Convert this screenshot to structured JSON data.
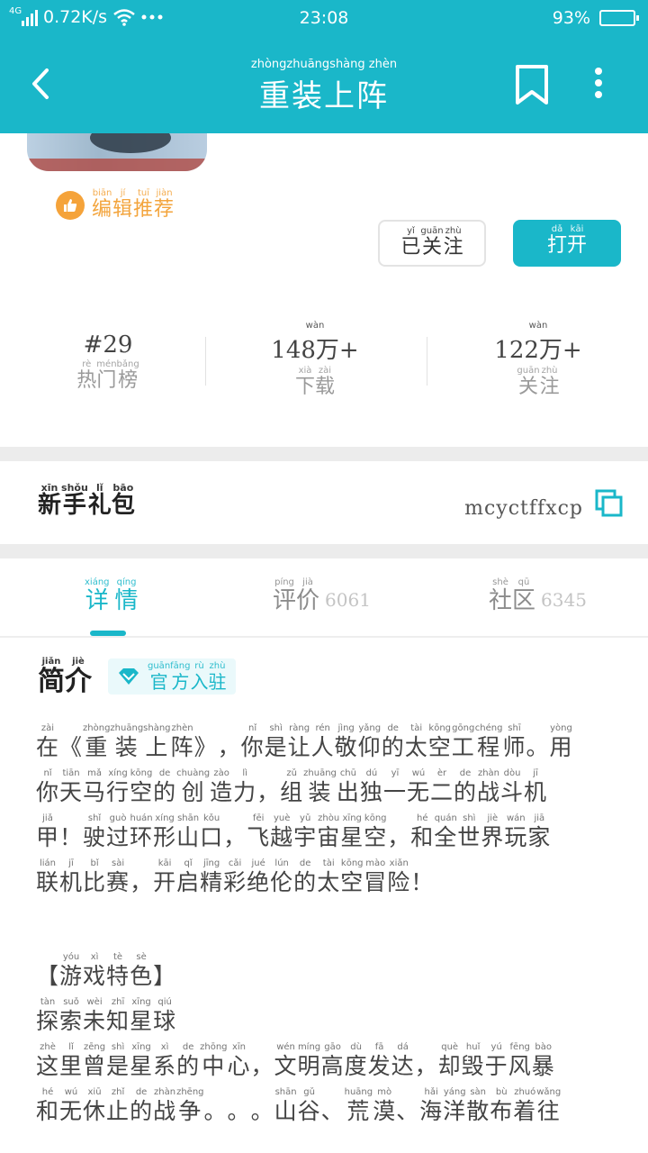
{
  "status_bar": {
    "network": "4G",
    "speed": "0.72K/s",
    "time": "23:08",
    "battery": "93%",
    "battery_level": 0.93
  },
  "header": {
    "title": "重装上阵",
    "title_pinyin": "zhòngzhuāngshàng zhèn",
    "icons": [
      "back-icon",
      "bookmark-icon",
      "more-icon"
    ]
  },
  "hero": {
    "recommend": {
      "chars": [
        "编",
        "辑",
        "推",
        "荐"
      ],
      "pinyin": [
        "biān",
        "jí",
        "tuī",
        "jiàn"
      ]
    },
    "followed_button": {
      "chars": [
        "已",
        "关",
        "注"
      ],
      "pinyin": [
        "yǐ",
        "guān",
        "zhù"
      ]
    },
    "open_button": {
      "chars": [
        "打",
        "开"
      ],
      "pinyin": [
        "dǎ",
        "kāi"
      ]
    }
  },
  "stats": [
    {
      "value": "#29",
      "value_pinyin": "",
      "chars": [
        "热",
        "门",
        "榜"
      ],
      "pinyin": [
        "rè",
        "mén",
        "bǎng"
      ]
    },
    {
      "value": "148万+",
      "value_pinyin": "wàn",
      "chars": [
        "下",
        "载"
      ],
      "pinyin": [
        "xià",
        "zài"
      ]
    },
    {
      "value": "122万+",
      "value_pinyin": "wàn",
      "chars": [
        "关",
        "注"
      ],
      "pinyin": [
        "guān",
        "zhù"
      ]
    }
  ],
  "gift": {
    "chars": [
      "新",
      "手",
      "礼",
      "包"
    ],
    "pinyin": [
      "xīn",
      "shǒu",
      "lǐ",
      "bāo"
    ],
    "code": "mcyctffxcp"
  },
  "tabs": [
    {
      "chars": [
        "详",
        "情"
      ],
      "pinyin": [
        "xiáng",
        "qíng"
      ],
      "count": ""
    },
    {
      "chars": [
        "评",
        "价"
      ],
      "pinyin": [
        "píng",
        "jià"
      ],
      "count": "6061"
    },
    {
      "chars": [
        "社",
        "区"
      ],
      "pinyin": [
        "shè",
        "qū"
      ],
      "count": "6345"
    }
  ],
  "intro": {
    "title": {
      "chars": [
        "简",
        "介"
      ],
      "pinyin": [
        "jiǎn",
        "jiè"
      ]
    },
    "badge": {
      "chars": [
        "官",
        "方",
        "入",
        "驻"
      ],
      "pinyin": [
        "guān",
        "fāng",
        "rù",
        "zhù"
      ]
    },
    "paragraph_lines": [
      [
        [
          "在",
          "zài"
        ],
        [
          "《",
          ""
        ],
        [
          "重",
          "zhòng"
        ],
        [
          "装",
          "zhuāng"
        ],
        [
          "上",
          "shàng"
        ],
        [
          "阵",
          "zhèn"
        ],
        [
          "》",
          ""
        ],
        [
          "，",
          ""
        ],
        [
          "你",
          "nǐ"
        ],
        [
          "是",
          "shì"
        ],
        [
          "让",
          "ràng"
        ],
        [
          "人",
          "rén"
        ],
        [
          "敬",
          "jìng"
        ],
        [
          "仰",
          "yǎng"
        ],
        [
          "的",
          "de"
        ],
        [
          "太",
          "tài"
        ],
        [
          "空",
          "kōng"
        ],
        [
          "工",
          "gōng"
        ],
        [
          "程",
          "chéng"
        ],
        [
          "师",
          "shī"
        ],
        [
          "。",
          ""
        ],
        [
          "用",
          "yòng"
        ]
      ],
      [
        [
          "你",
          "nǐ"
        ],
        [
          "天",
          "tiān"
        ],
        [
          "马",
          "mǎ"
        ],
        [
          "行",
          "xíng"
        ],
        [
          "空",
          "kōng"
        ],
        [
          "的",
          "de"
        ],
        [
          "创",
          "chuàng"
        ],
        [
          "造",
          "zào"
        ],
        [
          "力",
          "lì"
        ],
        [
          "，",
          ""
        ],
        [
          "组",
          "zǔ"
        ],
        [
          "装",
          "zhuāng"
        ],
        [
          "出",
          "chū"
        ],
        [
          "独",
          "dú"
        ],
        [
          "一",
          "yī"
        ],
        [
          "无",
          "wú"
        ],
        [
          "二",
          "èr"
        ],
        [
          "的",
          "de"
        ],
        [
          "战",
          "zhàn"
        ],
        [
          "斗",
          "dòu"
        ],
        [
          "机",
          "jī"
        ]
      ],
      [
        [
          "甲",
          "jiǎ"
        ],
        [
          "！",
          ""
        ],
        [
          "驶",
          "shǐ"
        ],
        [
          "过",
          "guò"
        ],
        [
          "环",
          "huán"
        ],
        [
          "形",
          "xíng"
        ],
        [
          "山",
          "shān"
        ],
        [
          "口",
          "kǒu"
        ],
        [
          "，",
          ""
        ],
        [
          "飞",
          "fēi"
        ],
        [
          "越",
          "yuè"
        ],
        [
          "宇",
          "yǔ"
        ],
        [
          "宙",
          "zhòu"
        ],
        [
          "星",
          "xīng"
        ],
        [
          "空",
          "kōng"
        ],
        [
          "，",
          ""
        ],
        [
          "和",
          "hé"
        ],
        [
          "全",
          "quán"
        ],
        [
          "世",
          "shì"
        ],
        [
          "界",
          "jiè"
        ],
        [
          "玩",
          "wán"
        ],
        [
          "家",
          "jiā"
        ]
      ],
      [
        [
          "联",
          "lián"
        ],
        [
          "机",
          "jī"
        ],
        [
          "比",
          "bǐ"
        ],
        [
          "赛",
          "sài"
        ],
        [
          "，",
          ""
        ],
        [
          "开",
          "kāi"
        ],
        [
          "启",
          "qǐ"
        ],
        [
          "精",
          "jīng"
        ],
        [
          "彩",
          "cǎi"
        ],
        [
          "绝",
          "jué"
        ],
        [
          "伦",
          "lún"
        ],
        [
          "的",
          "de"
        ],
        [
          "太",
          "tài"
        ],
        [
          "空",
          "kōng"
        ],
        [
          "冒",
          "mào"
        ],
        [
          "险",
          "xiǎn"
        ],
        [
          "！",
          ""
        ]
      ]
    ],
    "feature_lines": [
      [
        [
          "【",
          ""
        ],
        [
          "游",
          "yóu"
        ],
        [
          "戏",
          "xì"
        ],
        [
          "特",
          "tè"
        ],
        [
          "色",
          "sè"
        ],
        [
          "】",
          ""
        ]
      ],
      [
        [
          "探",
          "tàn"
        ],
        [
          "索",
          "suǒ"
        ],
        [
          "未",
          "wèi"
        ],
        [
          "知",
          "zhī"
        ],
        [
          "星",
          "xīng"
        ],
        [
          "球",
          "qiú"
        ]
      ],
      [
        [
          "这",
          "zhè"
        ],
        [
          "里",
          "lǐ"
        ],
        [
          "曾",
          "zēng"
        ],
        [
          "是",
          "shì"
        ],
        [
          "星",
          "xīng"
        ],
        [
          "系",
          "xì"
        ],
        [
          "的",
          "de"
        ],
        [
          "中",
          "zhōng"
        ],
        [
          "心",
          "xīn"
        ],
        [
          "，",
          ""
        ],
        [
          "文",
          "wén"
        ],
        [
          "明",
          "míng"
        ],
        [
          "高",
          "gāo"
        ],
        [
          "度",
          "dù"
        ],
        [
          "发",
          "fā"
        ],
        [
          "达",
          "dá"
        ],
        [
          "，",
          ""
        ],
        [
          "却",
          "què"
        ],
        [
          "毁",
          "huǐ"
        ],
        [
          "于",
          "yú"
        ],
        [
          "风",
          "fēng"
        ],
        [
          "暴",
          "bào"
        ]
      ],
      [
        [
          "和",
          "hé"
        ],
        [
          "无",
          "wú"
        ],
        [
          "休",
          "xiū"
        ],
        [
          "止",
          "zhǐ"
        ],
        [
          "的",
          "de"
        ],
        [
          "战",
          "zhàn"
        ],
        [
          "争",
          "zhēng"
        ],
        [
          "。",
          ""
        ],
        [
          "。",
          ""
        ],
        [
          "。",
          ""
        ],
        [
          "山",
          "shān"
        ],
        [
          "谷",
          "gǔ"
        ],
        [
          "、",
          ""
        ],
        [
          "荒",
          "huāng"
        ],
        [
          "漠",
          "mò"
        ],
        [
          "、",
          ""
        ],
        [
          "海",
          "hǎi"
        ],
        [
          "洋",
          "yáng"
        ],
        [
          "散",
          "sàn"
        ],
        [
          "布",
          "bù"
        ],
        [
          "着",
          "zhuó"
        ],
        [
          "往",
          "wǎng"
        ]
      ]
    ]
  },
  "colors": {
    "accent": "#1ab7c9",
    "recommend": "#f5a33a",
    "divider": "#ececec"
  }
}
